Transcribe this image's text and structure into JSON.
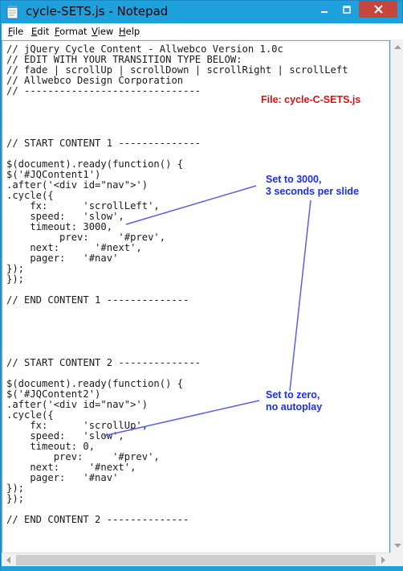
{
  "window": {
    "title": "cycle-SETS.js - Notepad",
    "app_icon": "notepad-icon",
    "frame_color": "#1ea0dc",
    "close_color": "#c7463b"
  },
  "menu": {
    "file": "File",
    "edit": "Edit",
    "format": "Format",
    "view": "View",
    "help": "Help"
  },
  "code_lines": [
    "// jQuery Cycle Content - Allwebco Version 1.0c",
    "// EDIT WITH YOUR TRANSITION TYPE BELOW:",
    "// fade | scrollUp | scrollDown | scrollRight | scrollLeft",
    "// Allwebco Design Corporation",
    "// ------------------------------",
    "",
    "",
    "",
    "",
    "// START CONTENT 1 --------------",
    "",
    "$(document).ready(function() {",
    "$('#JQContent1')",
    ".after('<div id=\"nav\">')",
    ".cycle({",
    "    fx:      'scrollLeft',",
    "    speed:   'slow',",
    "    timeout: 3000,",
    "         prev:     '#prev',",
    "    next:      '#next',",
    "    pager:   '#nav'",
    "});",
    "});",
    "",
    "// END CONTENT 1 --------------",
    "",
    "",
    "",
    "",
    "",
    "// START CONTENT 2 --------------",
    "",
    "$(document).ready(function() {",
    "$('#JQContent2')",
    ".after('<div id=\"nav\">')",
    ".cycle({",
    "    fx:      'scrollUp',",
    "    speed:   'slow',",
    "    timeout: 0,",
    "        prev:     '#prev',",
    "    next:     '#next',",
    "    pager:   '#nav'",
    "});",
    "});",
    "",
    "// END CONTENT 2 --------------"
  ],
  "annotations": {
    "file_label": "File: cycle-C-SETS.js",
    "file_label_color": "#e01010",
    "note1": "Set to 3000,\n3 seconds per slide",
    "note2": "Set to zero,\nno autoplay",
    "note_color": "#1a2ef0"
  }
}
